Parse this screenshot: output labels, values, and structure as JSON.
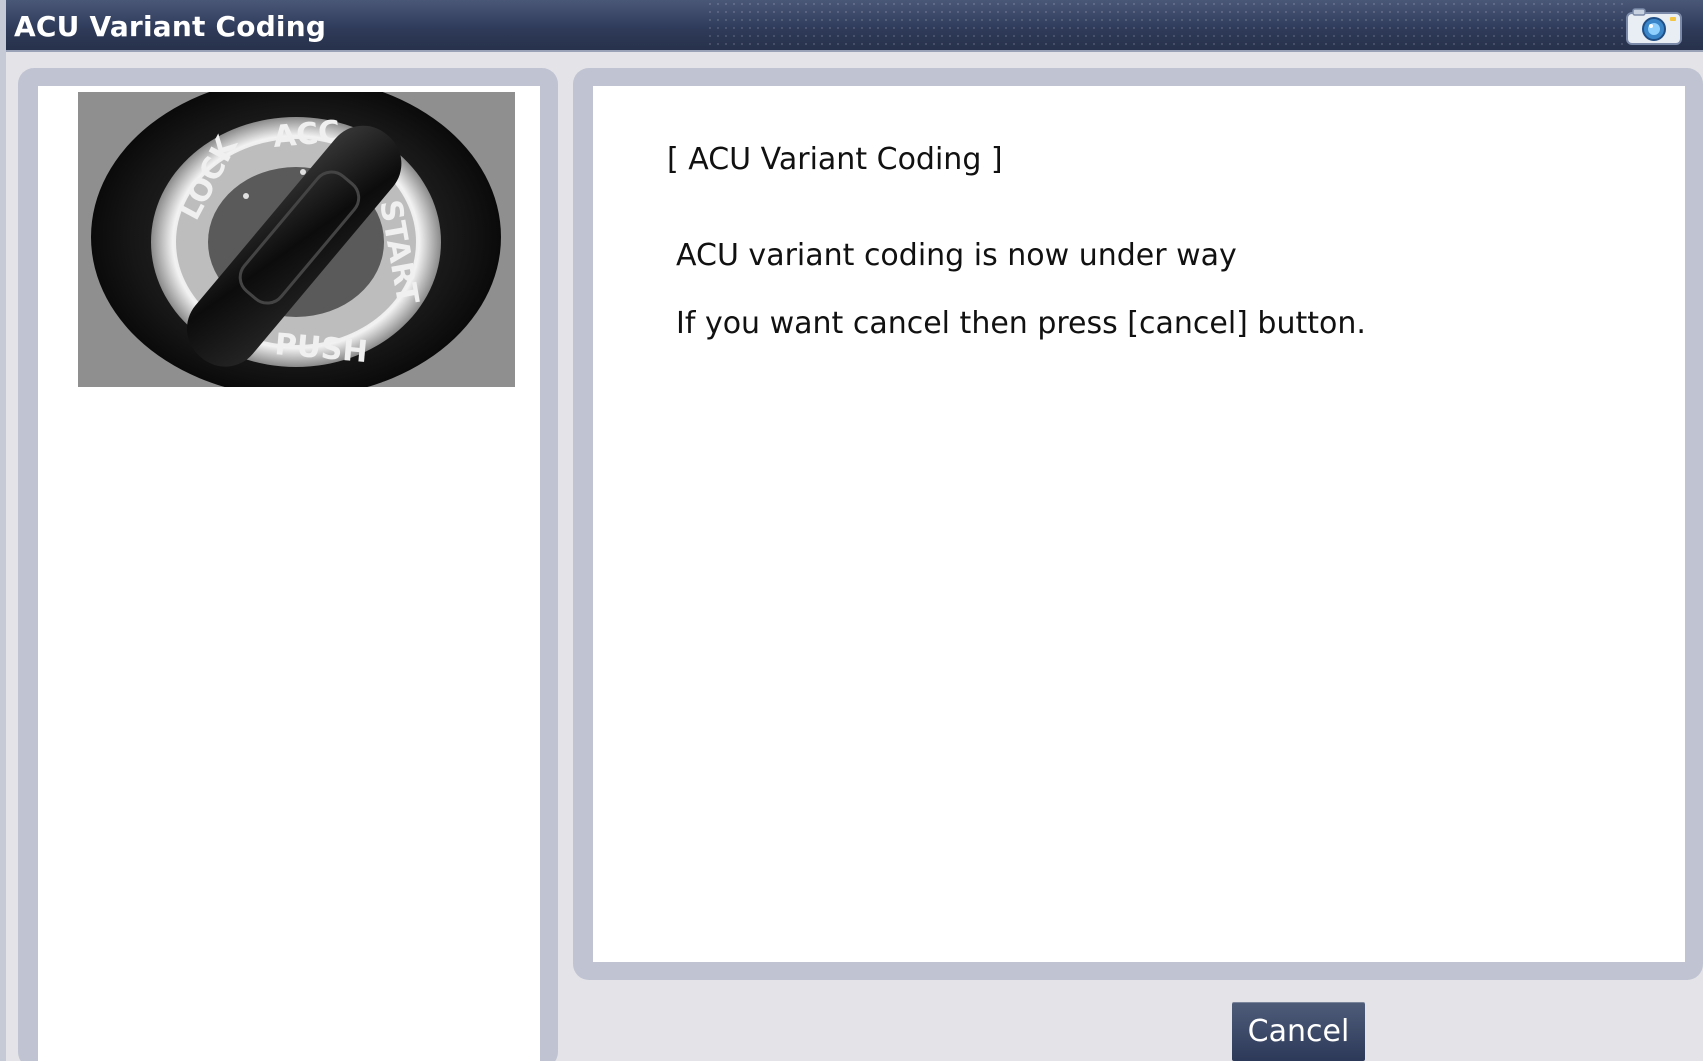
{
  "window": {
    "title": "ACU Variant Coding"
  },
  "icons": {
    "titlebar": "camera-icon",
    "illustration": "ignition-key-switch-image"
  },
  "illustration": {
    "switch_labels": [
      "LOCK",
      "ACC",
      "START",
      "PUSH"
    ]
  },
  "message": {
    "heading": "[ ACU Variant Coding ]",
    "lines": [
      "ACU variant coding is now under way",
      "If you want cancel then press [cancel] button."
    ]
  },
  "buttons": {
    "cancel_label": "Cancel"
  },
  "colors": {
    "titlebar": "#2e3a58",
    "panel_frame": "#c0c4d2",
    "button": "#3a4766"
  }
}
